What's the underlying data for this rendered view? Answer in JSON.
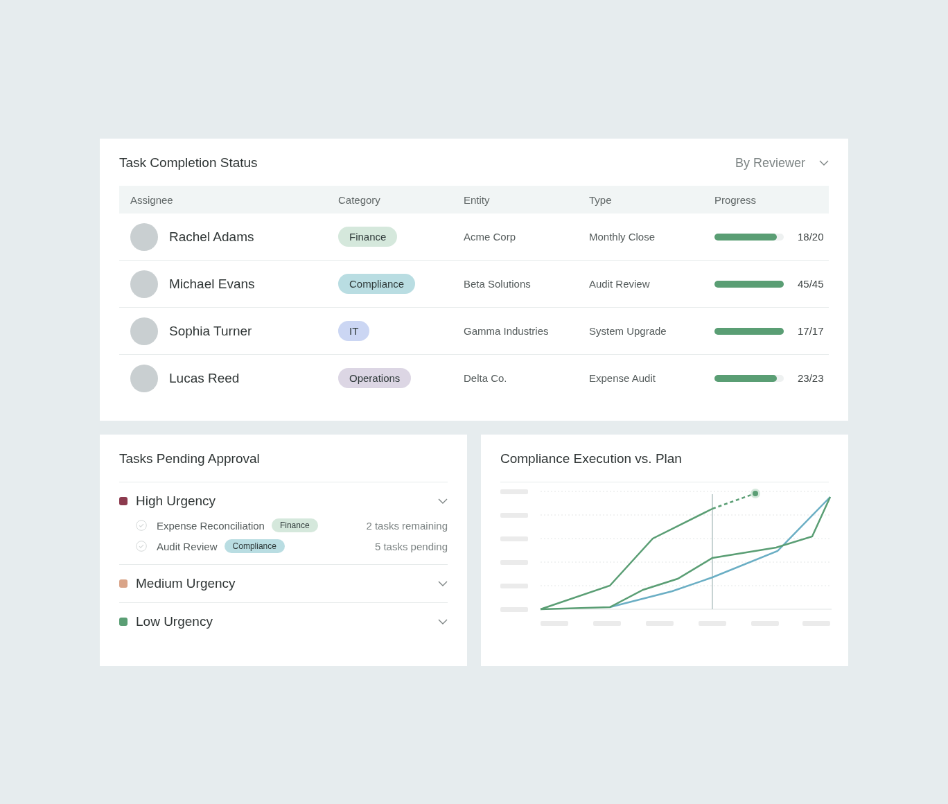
{
  "task_completion": {
    "title": "Task Completion Status",
    "filter": "By Reviewer",
    "columns": [
      "Assignee",
      "Category",
      "Entity",
      "Type",
      "Progress"
    ],
    "rows": [
      {
        "assignee": "Rachel Adams",
        "category": {
          "label": "Finance",
          "color": "#d5e8dc"
        },
        "entity": "Acme Corp",
        "type": "Monthly Close",
        "level": 0.9,
        "count": "18/20"
      },
      {
        "assignee": "Michael Evans",
        "category": {
          "label": "Compliance",
          "color": "#b9dde2"
        },
        "entity": "Beta Solutions",
        "type": "Audit Review",
        "level": 1,
        "count": "45/45"
      },
      {
        "assignee": "Sophia Turner",
        "category": {
          "label": "IT",
          "color": "#cbd6f3"
        },
        "entity": "Gamma Industries",
        "type": "System Upgrade",
        "level": 1,
        "count": "17/17"
      },
      {
        "assignee": "Lucas Reed",
        "category": {
          "label": "Operations",
          "color": "#dcd6e4"
        },
        "entity": "Delta Co.",
        "type": "Expense Audit",
        "level": 0.9,
        "count": "23/23"
      }
    ]
  },
  "pending_approval": {
    "title": "Tasks Pending Approval",
    "groups": [
      {
        "label": "High Urgency",
        "color": "#8c3a4e",
        "tasks": [
          {
            "name": "Expense Reconciliation",
            "tag": {
              "label": "Finance",
              "color": "#d5e8dc"
            },
            "status": "2 tasks remaining"
          },
          {
            "name": "Audit Review",
            "tag": {
              "label": "Compliance",
              "color": "#b9dde2"
            },
            "status": "5 tasks pending"
          }
        ]
      },
      {
        "label": "Medium Urgency",
        "color": "#d9a488"
      },
      {
        "label": "Low Urgency",
        "color": "#5a9e74"
      }
    ]
  },
  "compliance_chart": {
    "title": "Compliance Execution vs. Plan"
  }
}
